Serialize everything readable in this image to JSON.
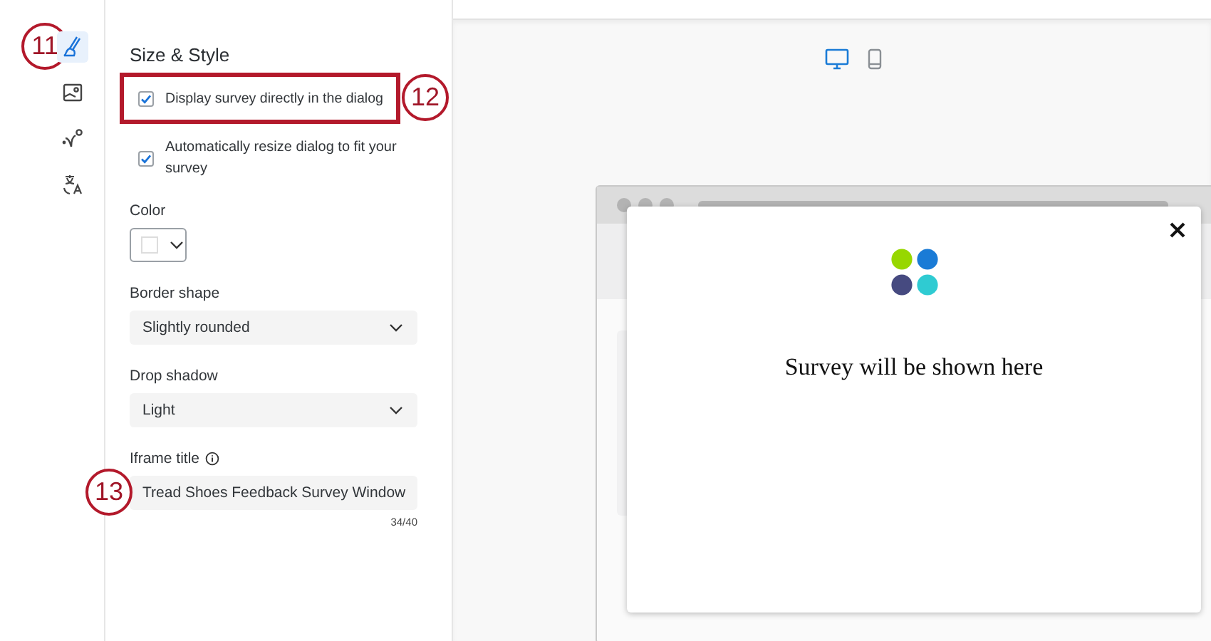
{
  "rail": [
    {
      "kind": "brush",
      "selected": true,
      "callout": "11"
    },
    {
      "kind": "image",
      "selected": false
    },
    {
      "kind": "path",
      "selected": false
    },
    {
      "kind": "translate",
      "selected": false
    }
  ],
  "panel": {
    "title": "Size & Style",
    "checkboxes": [
      {
        "label": "Display survey directly in the dialog",
        "checked": true,
        "highlighted": true,
        "callout": "12"
      },
      {
        "label": "Automatically resize dialog to fit your survey",
        "checked": true,
        "highlighted": false
      }
    ],
    "color": {
      "label": "Color"
    },
    "selects": [
      {
        "label": "Border shape",
        "value": "Slightly rounded"
      },
      {
        "label": "Drop shadow",
        "value": "Light"
      }
    ],
    "iframe_title": {
      "label": "Iframe title",
      "value": "Tread Shoes Feedback Survey Window",
      "counter": "34/40",
      "callout": "13"
    }
  },
  "preview": {
    "devices": [
      {
        "kind": "desktop",
        "selected": true
      },
      {
        "kind": "mobile",
        "selected": false
      }
    ],
    "dialog": {
      "message": "Survey will be shown here"
    }
  }
}
